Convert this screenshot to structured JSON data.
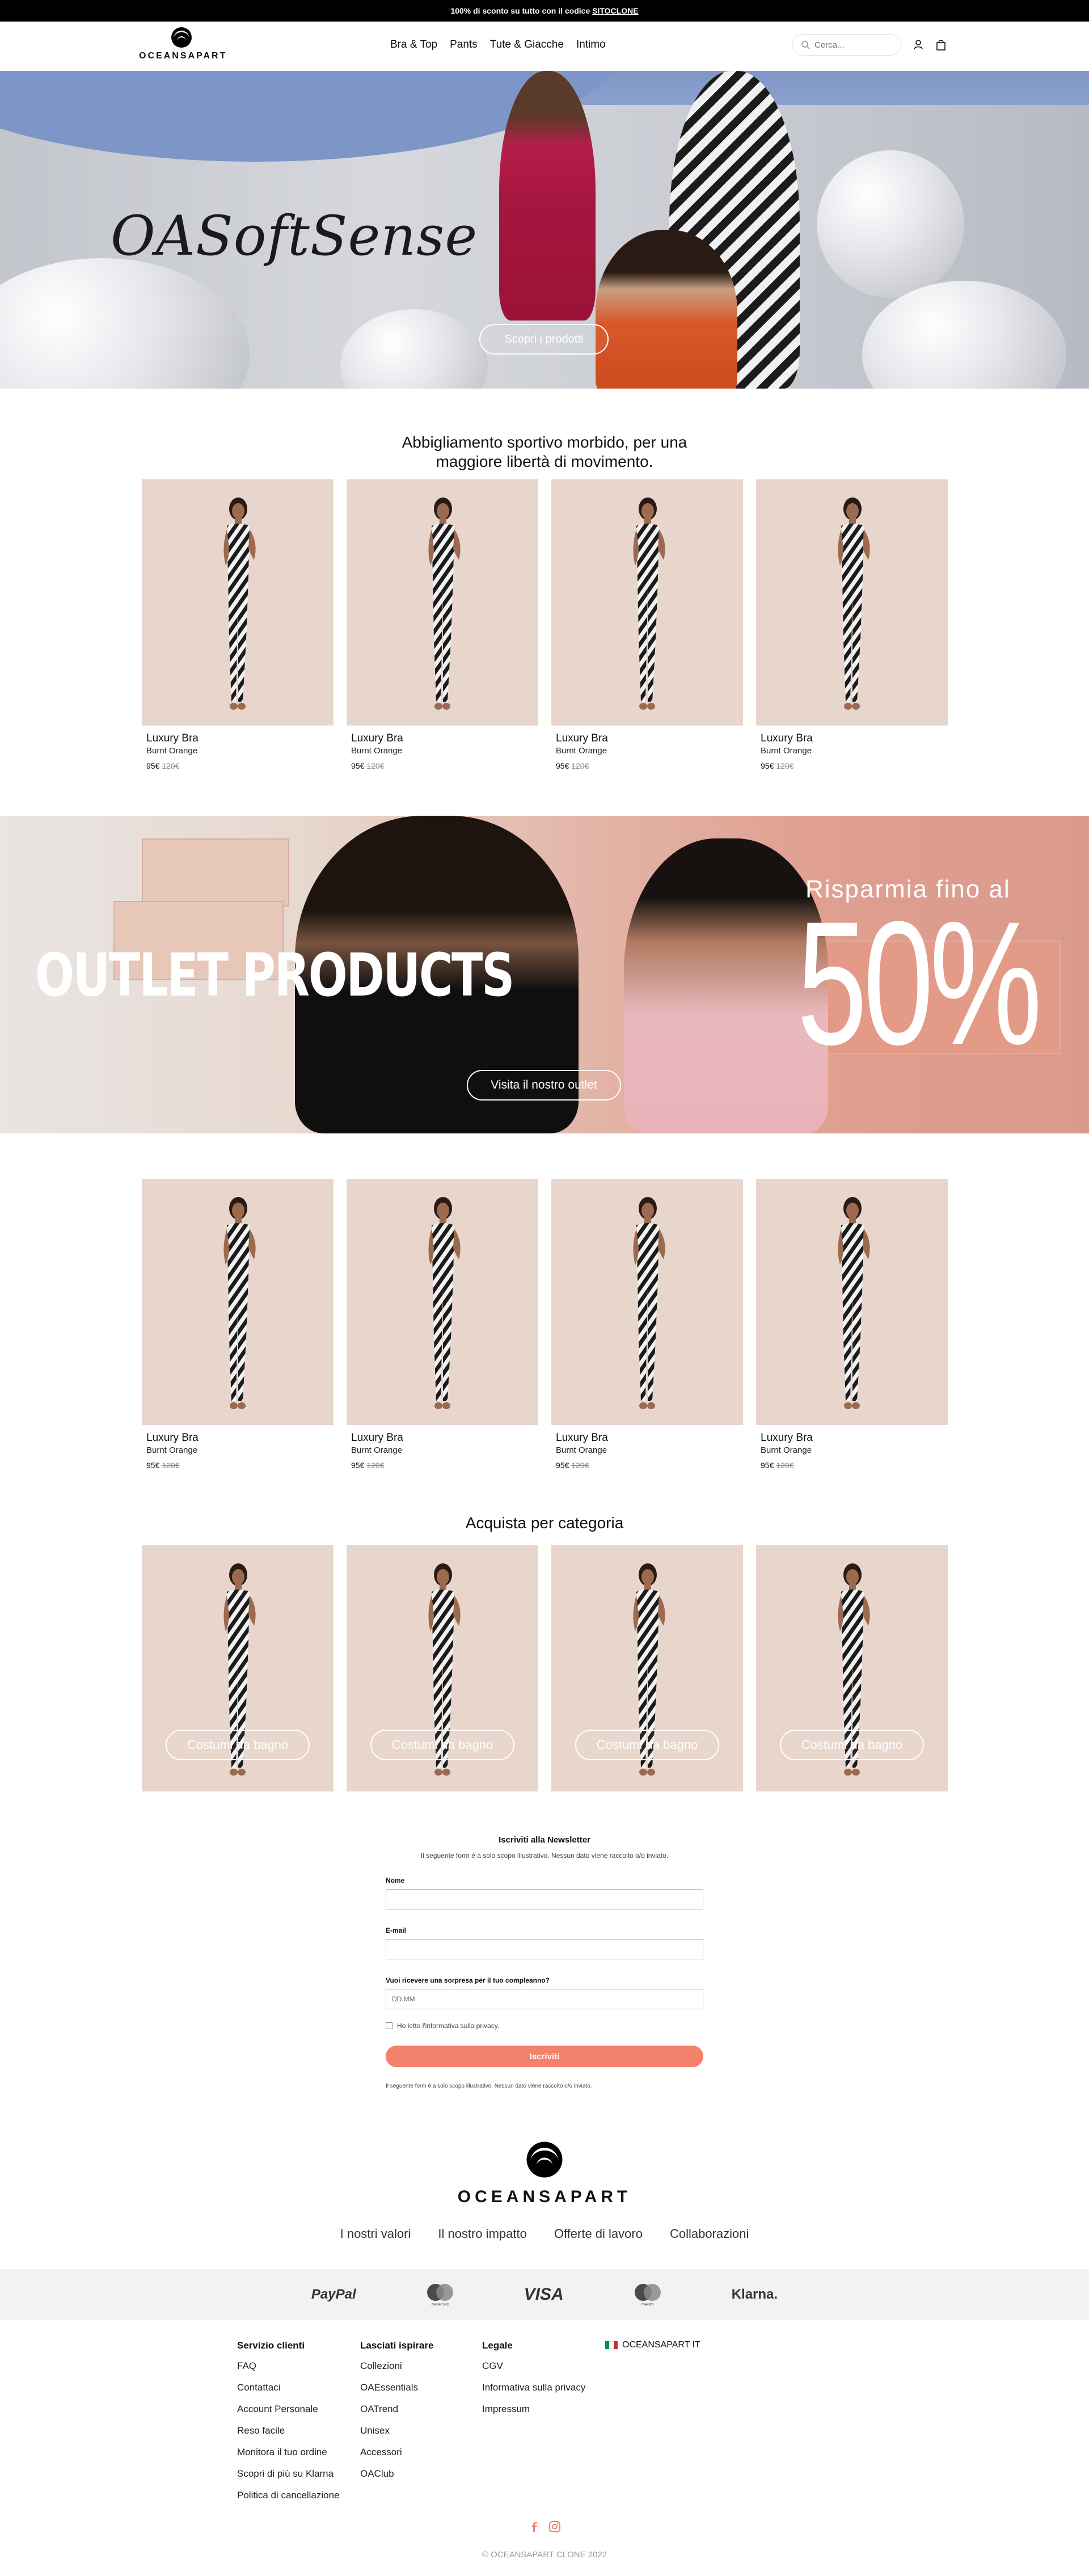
{
  "announcement": {
    "text_prefix": "100% di sconto su tutto con il codice ",
    "code": "SITOCLONE"
  },
  "header": {
    "logo_text": "OCEANSAPART",
    "nav": [
      "Bra & Top",
      "Pants",
      "Tute & Giacche",
      "Intimo"
    ],
    "search_placeholder": "Cerca...",
    "icons": [
      "search-icon",
      "user-icon",
      "bag-icon"
    ]
  },
  "hero": {
    "title": "OASoftSense",
    "button": "Scopri i prodotti"
  },
  "section1": {
    "heading_line1": "Abbigliamento sportivo morbido, per una",
    "heading_line2": "maggiore libertà di movimento.",
    "products": [
      {
        "name": "Luxury Bra",
        "color": "Burnt Orange",
        "price": "95€",
        "old_price": "120€"
      },
      {
        "name": "Luxury Bra",
        "color": "Burnt Orange",
        "price": "95€",
        "old_price": "120€"
      },
      {
        "name": "Luxury Bra",
        "color": "Burnt Orange",
        "price": "95€",
        "old_price": "120€"
      },
      {
        "name": "Luxury Bra",
        "color": "Burnt Orange",
        "price": "95€",
        "old_price": "120€"
      }
    ]
  },
  "outlet": {
    "title": "OUTLET PRODUCTS",
    "subtitle": "Risparmia fino al",
    "percent": "50%",
    "button": "Visita il nostro outlet"
  },
  "section2": {
    "products": [
      {
        "name": "Luxury Bra",
        "color": "Burnt Orange",
        "price": "95€",
        "old_price": "120€"
      },
      {
        "name": "Luxury Bra",
        "color": "Burnt Orange",
        "price": "95€",
        "old_price": "120€"
      },
      {
        "name": "Luxury Bra",
        "color": "Burnt Orange",
        "price": "95€",
        "old_price": "120€"
      },
      {
        "name": "Luxury Bra",
        "color": "Burnt Orange",
        "price": "95€",
        "old_price": "120€"
      }
    ]
  },
  "categories": {
    "heading": "Acquista per categoria",
    "items": [
      "Costumi da bagno",
      "Costumi da bagno",
      "Costumi da bagno",
      "Costumi da bagno"
    ]
  },
  "newsletter": {
    "title": "Iscriviti alla Newsletter",
    "description": "Il seguente form è a solo scopo illustrativo. Nessun dato viene raccolto o/o inviato.",
    "name_label": "Nome",
    "email_label": "E-mail",
    "birthday_label": "Vuoi ricevere una sorpresa per il tuo compleanno?",
    "birthday_placeholder": "DD.MM",
    "privacy_label": "Ho letto l'informativa sulla privacy.",
    "submit": "Iscriviti",
    "footnote": "Il seguente form è a solo scopo illustrativo. Nessun dato viene raccolto o/o inviato."
  },
  "brand": {
    "name": "OCEANSAPART",
    "links": [
      "I nostri valori",
      "Il nostro impatto",
      "Offerte di lavoro",
      "Collaborazioni"
    ]
  },
  "payments": [
    {
      "name": "PayPal",
      "caption": ""
    },
    {
      "name": "mastercard",
      "caption": "mastercard"
    },
    {
      "name": "VISA",
      "caption": ""
    },
    {
      "name": "maestro",
      "caption": "maestro"
    },
    {
      "name": "Klarna.",
      "caption": ""
    }
  ],
  "footer": {
    "columns": [
      {
        "heading": "Servizio clienti",
        "items": [
          "FAQ",
          "Contattaci",
          "Account Personale",
          "Reso facile",
          "Monitora il tuo ordine",
          "Scopri di più su Klarna",
          "Politica di cancellazione"
        ]
      },
      {
        "heading": "Lasciati ispirare",
        "items": [
          "Collezioni",
          "OAEssentials",
          "OATrend",
          "Unisex",
          "Accessori",
          "OAClub"
        ]
      },
      {
        "heading": "Legale",
        "items": [
          "CGV",
          "Informativa sulla privacy",
          "Impressum"
        ]
      }
    ],
    "region": "OCEANSAPART IT",
    "social": [
      "facebook-icon",
      "instagram-icon"
    ],
    "copyright": "© OCEANSAPART CLONE 2022"
  },
  "colors": {
    "accent": "#f4816b",
    "card_bg": "#e8d5cc",
    "social": "#f4816b"
  }
}
